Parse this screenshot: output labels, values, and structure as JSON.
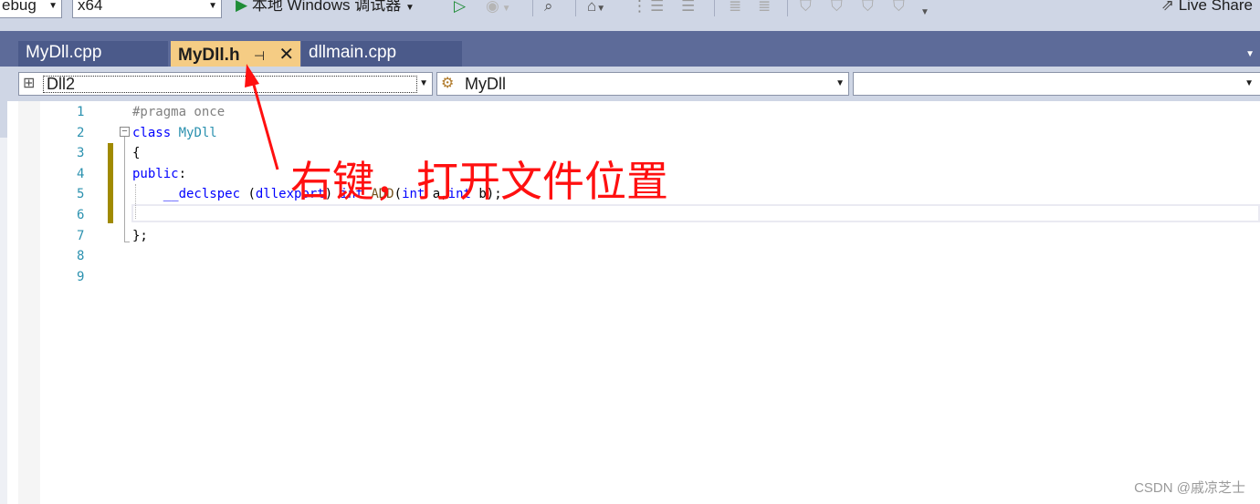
{
  "toolbar": {
    "config_value": "ebug",
    "platform_value": "x64",
    "run_label": "本地 Windows 调试器",
    "live_share_label": "Live Share"
  },
  "tabs": [
    {
      "label": "MyDll.cpp",
      "active": false
    },
    {
      "label": "MyDll.h",
      "active": true
    },
    {
      "label": "dllmain.cpp",
      "active": false
    }
  ],
  "navbar": {
    "project_value": "Dll2",
    "class_value": "MyDll",
    "member_value": ""
  },
  "editor": {
    "line_numbers": [
      "1",
      "2",
      "3",
      "4",
      "5",
      "6",
      "7",
      "8",
      "9"
    ],
    "lines": {
      "l1_pp": "#pragma once",
      "l2_kw": "class",
      "l2_cls": "MyDll",
      "l3": "{",
      "l4_kw": "public",
      "l4_rest": ":",
      "l5_kw1": "__declspec",
      "l5_p1": " (",
      "l5_macro": "dllexport",
      "l5_p2": ") ",
      "l5_kw2": "int",
      "l5_sp": " ",
      "l5_fn": "ADD",
      "l5_p3": "(",
      "l5_kw3": "int",
      "l5_p4": " a,",
      "l5_kw4": "int",
      "l5_p5": " b);",
      "l7": "};"
    }
  },
  "annotation": {
    "text": "右键，打开文件位置",
    "color": "#ff1010"
  },
  "watermark": "CSDN @戚凉芝士",
  "colors": {
    "tab_active": "#f5cc84",
    "tabstrip": "#5d6b99",
    "toolbar": "#cfd6e5",
    "keyword": "#0000ff",
    "type": "#2b91af"
  }
}
